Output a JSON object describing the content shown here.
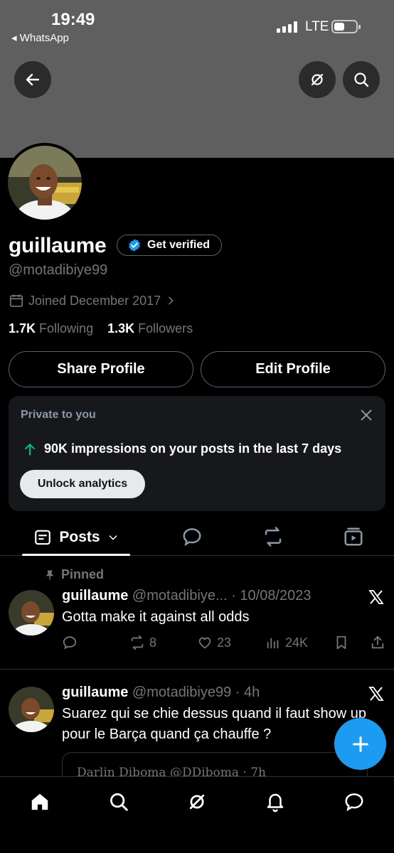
{
  "status_bar": {
    "time": "19:49",
    "back_app": "◂ WhatsApp",
    "network": "LTE"
  },
  "profile": {
    "display_name": "guillaume",
    "verify_label": "Get verified",
    "handle": "@motadibiye99",
    "joined": "Joined December 2017",
    "following_count": "1.7K",
    "following_label": "Following",
    "followers_count": "1.3K",
    "followers_label": "Followers",
    "share_label": "Share Profile",
    "edit_label": "Edit Profile"
  },
  "private_card": {
    "title": "Private to you",
    "impressions_text": "90K impressions on your posts in the last 7 days",
    "unlock_label": "Unlock analytics"
  },
  "tabs": {
    "posts_label": "Posts"
  },
  "pinned_label": "Pinned",
  "tweets": [
    {
      "name": "guillaume",
      "meta": "@motadibiye... · 10/08/2023",
      "text": "Gotta make it against all odds",
      "retweets": "8",
      "likes": "23",
      "views": "24K"
    },
    {
      "name": "guillaume",
      "meta": "@motadibiye99 · 4h",
      "text": "Suarez qui se chie dessus quand il faut show up pour le Barça quand ça chauffe ?",
      "quote_preview": "Darlin Diboma @DDiboma · 7h"
    }
  ],
  "colors": {
    "accent": "#1d9bf0",
    "banner": "#5f5f5f",
    "card": "#16181c",
    "muted": "#71767b",
    "green": "#00ba7c"
  }
}
